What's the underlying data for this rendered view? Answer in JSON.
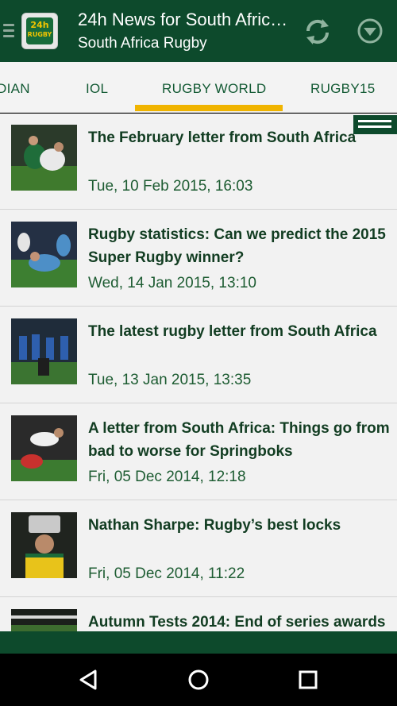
{
  "header": {
    "title": "24h News for South Africa…",
    "subtitle": "South Africa Rugby",
    "logo_text_top": "24h",
    "logo_text_bottom": "RUGBY"
  },
  "icons": {
    "drawer": "drawer-icon",
    "refresh": "refresh-icon",
    "dropdown": "chevron-down-circle-icon",
    "back": "back-icon",
    "home": "home-icon",
    "recents": "recents-icon"
  },
  "colors": {
    "brand_green": "#0d4a2c",
    "accent_yellow": "#f0b400",
    "title_green": "#123d22",
    "list_background": "#f2f2f2"
  },
  "tabs": [
    {
      "label": "DIAN"
    },
    {
      "label": "IOL"
    },
    {
      "label": "RUGBY WORLD",
      "selected": true
    },
    {
      "label": "RUGBY15"
    }
  ],
  "articles": [
    {
      "title": "The February letter from South Africa",
      "date": "Tue, 10 Feb 2015, 16:03"
    },
    {
      "title": "Rugby statistics: Can we predict the 2015 Super Rugby winner?",
      "date": "Wed, 14 Jan 2015, 13:10"
    },
    {
      "title": "The latest rugby letter from South Africa",
      "date": "Tue, 13 Jan 2015, 13:35"
    },
    {
      "title": "A letter from South Africa: Things go from bad to worse for Springboks",
      "date": "Fri, 05 Dec 2014, 12:18"
    },
    {
      "title": "Nathan Sharpe: Rugby’s best locks",
      "date": "Fri, 05 Dec 2014, 11:22"
    },
    {
      "title": "Autumn Tests 2014: End of series awards",
      "date": ""
    }
  ]
}
